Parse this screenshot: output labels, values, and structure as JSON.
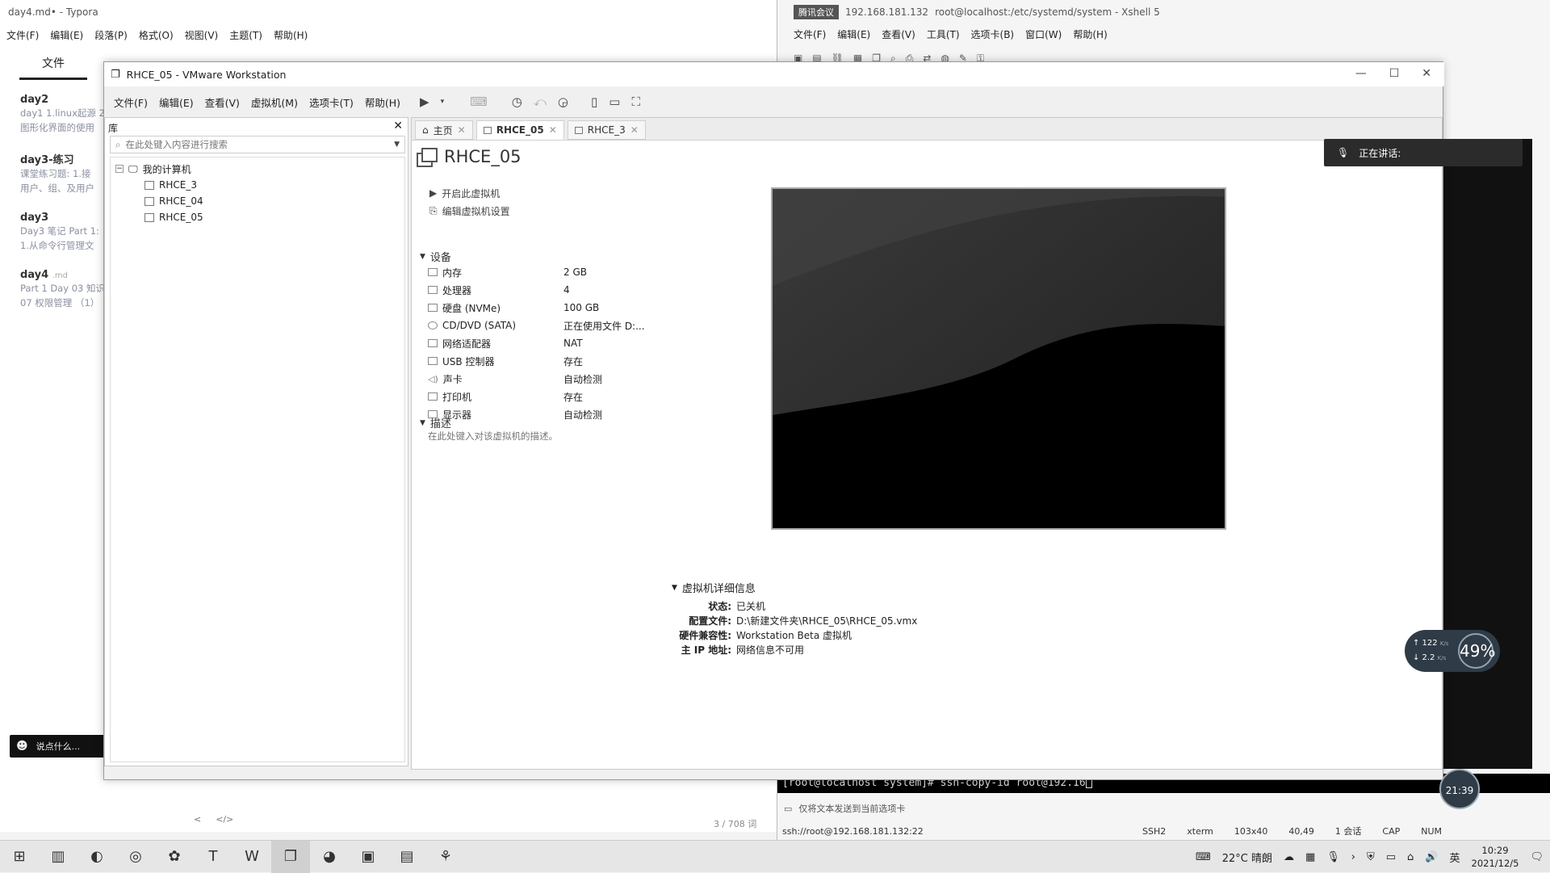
{
  "typora": {
    "title": "day4.md• - Typora",
    "menu": [
      "文件(F)",
      "编辑(E)",
      "段落(P)",
      "格式(O)",
      "视图(V)",
      "主题(T)",
      "帮助(H)"
    ],
    "side_tab": "文件",
    "files": [
      {
        "title": "day2",
        "lines": [
          "day1 1.linux起源 2",
          "图形化界面的使用"
        ]
      },
      {
        "title": "day3-练习",
        "lines": [
          "课堂练习题:  1.接",
          "用户、组、及用户"
        ]
      },
      {
        "title": "day3",
        "lines": [
          "Day3 笔记 Part 1:",
          "1.从命令行管理文"
        ]
      },
      {
        "title": "day4",
        "suffix": ".md",
        "lines": [
          "Part 1 Day 03 知识",
          "07 权限管理 （1）"
        ]
      }
    ],
    "footer_left": "<",
    "footer_code": "</>",
    "word_count": "3 / 708 词",
    "chat_placeholder": "说点什么...",
    "chat_arrow": "‹"
  },
  "xshell": {
    "title": "root@localhost:/etc/systemd/system - Xshell 5",
    "title_prefix": "腾讯会议",
    "address": "192.168.181.132",
    "menu": [
      "文件(F)",
      "编辑(E)",
      "查看(V)",
      "工具(T)",
      "选项卡(B)",
      "窗口(W)",
      "帮助(H)"
    ],
    "terminal_line": "[root@localhost system]# ssh-copy-id root@192.16",
    "send_text": "仅将文本发送到当前选项卡",
    "status": {
      "conn": "ssh://root@192.168.181.132:22",
      "proto": "SSH2",
      "term": "xterm",
      "size": "103x40",
      "pos": "40,49",
      "sessions": "1 会话",
      "caps": "CAP",
      "num": "NUM"
    }
  },
  "vmware": {
    "title": "RHCE_05 - VMware Workstation",
    "menu": [
      "文件(F)",
      "编辑(E)",
      "查看(V)",
      "虚拟机(M)",
      "选项卡(T)",
      "帮助(H)"
    ],
    "library": {
      "header": "库",
      "search_placeholder": "在此处键入内容进行搜索",
      "root": "我的计算机",
      "vms": [
        "RHCE_3",
        "RHCE_04",
        "RHCE_05"
      ]
    },
    "tabs": [
      {
        "label": "主页",
        "icon": "home-icon"
      },
      {
        "label": "RHCE_05",
        "icon": "vm-icon",
        "active": true
      },
      {
        "label": "RHCE_3",
        "icon": "vm-icon"
      }
    ],
    "vm_name": "RHCE_05",
    "actions": {
      "power_on": "开启此虚拟机",
      "edit": "编辑虚拟机设置"
    },
    "devices_title": "设备",
    "devices": [
      {
        "name": "内存",
        "value": "2 GB"
      },
      {
        "name": "处理器",
        "value": "4"
      },
      {
        "name": "硬盘 (NVMe)",
        "value": "100 GB"
      },
      {
        "name": "CD/DVD (SATA)",
        "value": "正在使用文件 D:..."
      },
      {
        "name": "网络适配器",
        "value": "NAT"
      },
      {
        "name": "USB 控制器",
        "value": "存在"
      },
      {
        "name": "声卡",
        "value": "自动检测"
      },
      {
        "name": "打印机",
        "value": "存在"
      },
      {
        "name": "显示器",
        "value": "自动检测"
      }
    ],
    "description_title": "描述",
    "description_hint": "在此处键入对该虚拟机的描述。",
    "details_title": "虚拟机详细信息",
    "details": [
      {
        "key": "状态:",
        "value": "已关机"
      },
      {
        "key": "配置文件:",
        "value": "D:\\新建文件夹\\RHCE_05\\RHCE_05.vmx"
      },
      {
        "key": "硬件兼容性:",
        "value": "Workstation Beta 虚拟机"
      },
      {
        "key": "主 IP 地址:",
        "value": "网络信息不可用"
      }
    ]
  },
  "overlays": {
    "speaking": "正在讲话:",
    "net_up": "↑ 122",
    "net_up_unit": "K/s",
    "net_down": "↓ 2.2",
    "net_down_unit": "K/s",
    "net_pct": "49%",
    "timer": "21:39"
  },
  "taskbar": {
    "weather": "22°C 晴朗",
    "ime": "英",
    "time": "10:29",
    "date": "2021/12/5"
  }
}
